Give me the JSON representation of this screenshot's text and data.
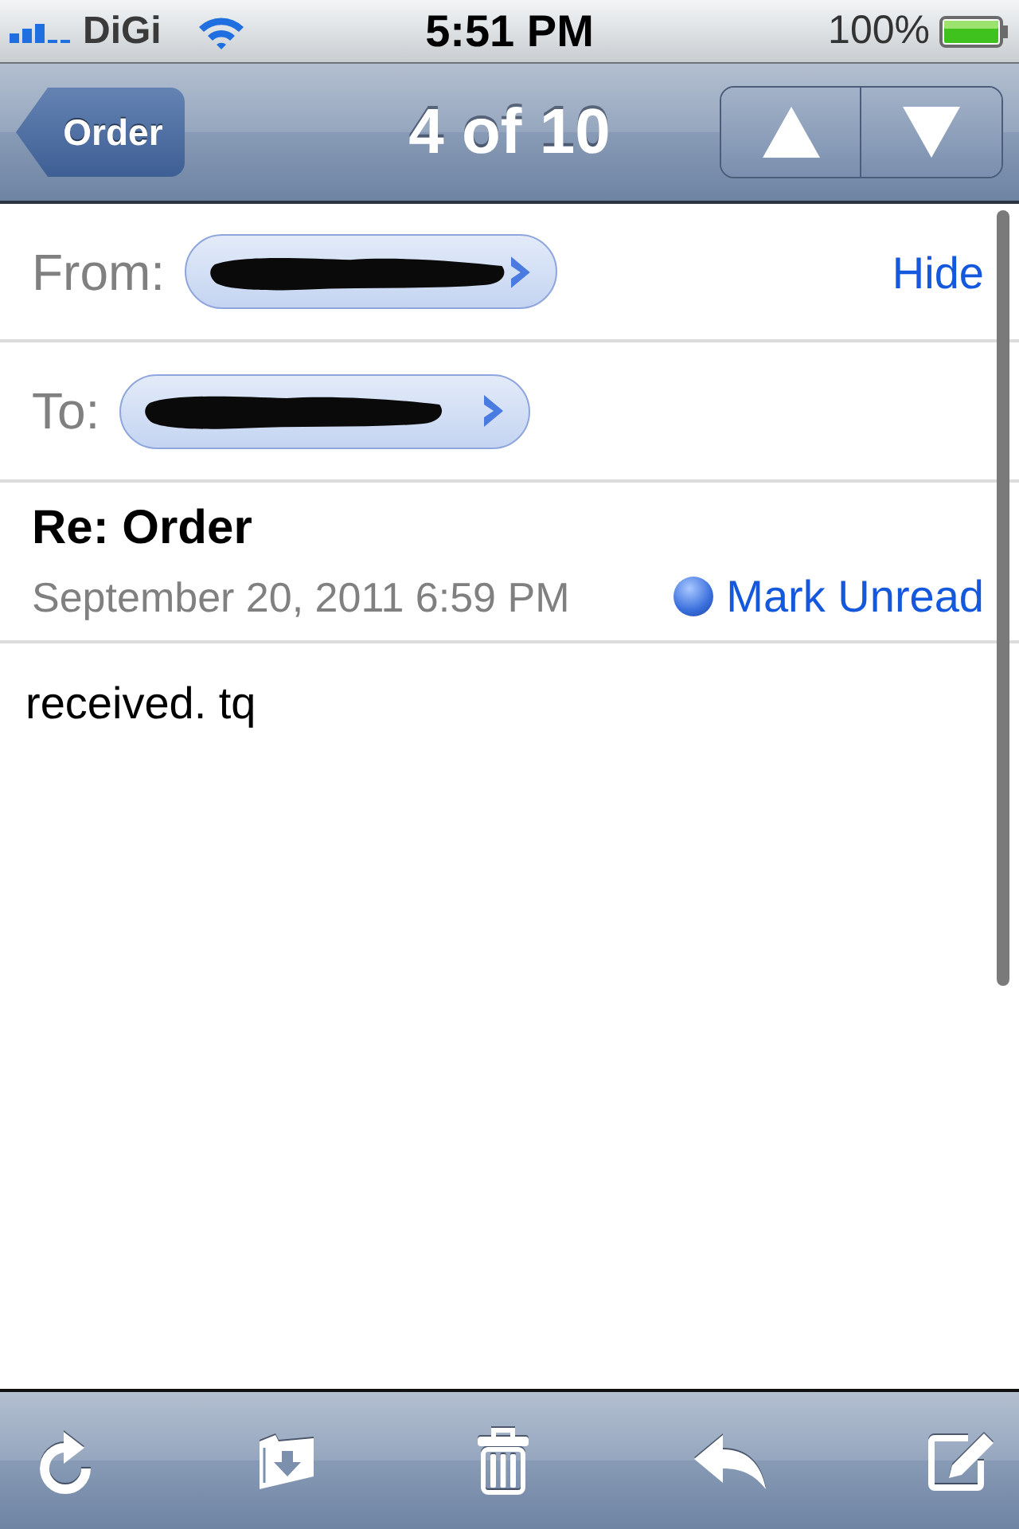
{
  "status_bar": {
    "carrier": "DiGi",
    "time": "5:51 PM",
    "battery": "100%"
  },
  "nav_bar": {
    "back_button": "Order",
    "title": "4 of 10"
  },
  "header": {
    "from_label": "From:",
    "hide_link": "Hide",
    "to_label": "To:"
  },
  "message": {
    "subject": "Re: Order",
    "date": "September 20, 2011 6:59 PM",
    "mark_unread": "Mark Unread",
    "body": "received. tq"
  }
}
